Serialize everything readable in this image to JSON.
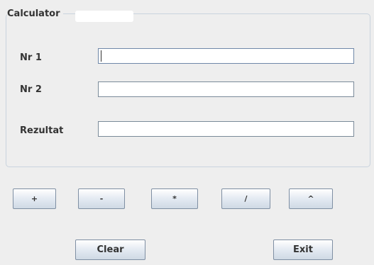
{
  "window": {
    "group_title": "Calculator"
  },
  "form": {
    "nr1_label": "Nr 1",
    "nr1_value": "",
    "nr2_label": "Nr 2",
    "nr2_value": "",
    "result_label": "Rezultat",
    "result_value": ""
  },
  "operators": {
    "add": "+",
    "subtract": "-",
    "multiply": "*",
    "divide": "/",
    "power": "^"
  },
  "actions": {
    "clear_label": "Clear",
    "exit_label": "Exit"
  }
}
